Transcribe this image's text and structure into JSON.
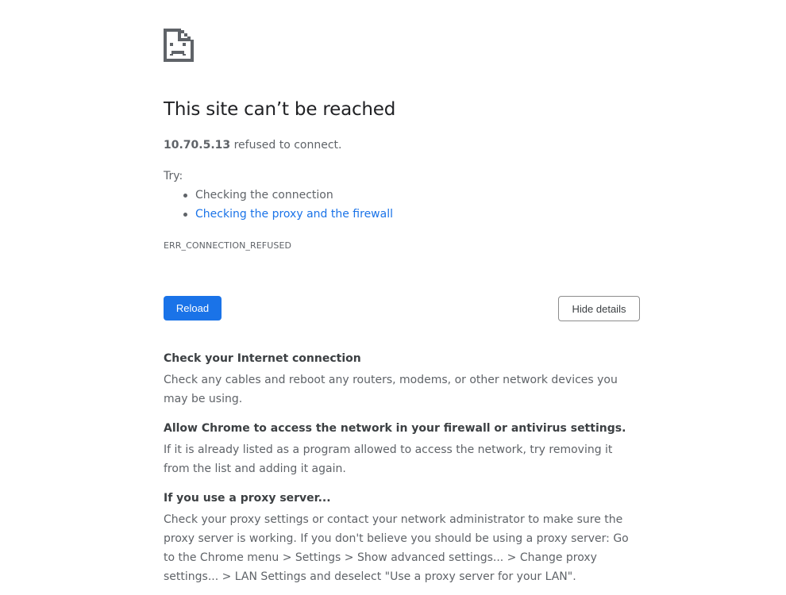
{
  "error": {
    "title": "This site can’t be reached",
    "host": "10.70.5.13",
    "summary_suffix": " refused to connect.",
    "try_label": "Try:",
    "suggestions": [
      {
        "text": "Checking the connection",
        "is_link": false
      },
      {
        "text": "Checking the proxy and the firewall",
        "is_link": true
      }
    ],
    "code": "ERR_CONNECTION_REFUSED"
  },
  "buttons": {
    "reload_label": "Reload",
    "details_label": "Hide details"
  },
  "details": [
    {
      "heading": "Check your Internet connection",
      "body": "Check any cables and reboot any routers, modems, or other network devices you may be using."
    },
    {
      "heading": "Allow Chrome to access the network in your firewall or antivirus settings.",
      "body": "If it is already listed as a program allowed to access the network, try removing it from the list and adding it again."
    },
    {
      "heading": "If you use a proxy server...",
      "body": "Check your proxy settings or contact your network administrator to make sure the proxy server is working. If you don't believe you should be using a proxy server: Go to the Chrome menu > Settings > Show advanced settings... > Change proxy settings... > LAN Settings and deselect \"Use a proxy server for your LAN\"."
    }
  ],
  "colors": {
    "accent": "#1a73e8",
    "text": "#5f6368",
    "heading": "#202124"
  },
  "icons": {
    "main": "sad-document-icon"
  }
}
